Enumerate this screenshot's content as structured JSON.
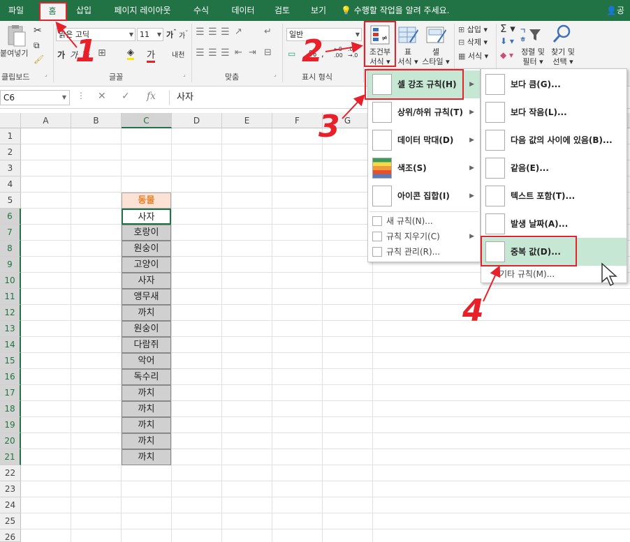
{
  "tabs": [
    "파일",
    "홈",
    "삽입",
    "페이지 레이아웃",
    "수식",
    "데이터",
    "검토",
    "보기"
  ],
  "active_tab": "홈",
  "tell_me": "수행할 작업을 알려 주세요.",
  "share_label": "공",
  "ribbon": {
    "paste_label": "붙여넣기",
    "clipboard_group": "클립보드",
    "font_name": "맑은 고딕",
    "font_size": "11",
    "font_group": "글꼴",
    "align_group": "맞춤",
    "number_format": "일반",
    "number_group": "표시 형식",
    "conditional_format_label_1": "조건부",
    "conditional_format_label_2": "서식",
    "table_format_label_1": "표",
    "table_format_label_2": "서식",
    "cell_style_label_1": "셀",
    "cell_style_label_2": "스타일",
    "insert_label": "삽입",
    "delete_label": "삭제",
    "format_label": "서식",
    "sort_filter_label_1": "정렬 및",
    "sort_filter_label_2": "필터",
    "find_select_label_1": "찾기 및",
    "find_select_label_2": "선택"
  },
  "formula_bar": {
    "name_box": "C6",
    "fx": "fx",
    "content": "사자"
  },
  "columns": [
    "A",
    "B",
    "C",
    "D",
    "E",
    "F",
    "G"
  ],
  "rows": [
    "1",
    "2",
    "3",
    "4",
    "5",
    "6",
    "7",
    "8",
    "9",
    "10",
    "11",
    "12",
    "13",
    "14",
    "15",
    "16",
    "17",
    "18",
    "19",
    "20",
    "21",
    "22",
    "23",
    "24",
    "25",
    "26"
  ],
  "cells": {
    "header": "동물",
    "values": [
      "사자",
      "호랑이",
      "원숭이",
      "고양이",
      "사자",
      "앵무새",
      "까치",
      "원숭이",
      "다람쥐",
      "악어",
      "독수리",
      "까치",
      "까치",
      "까치",
      "까치",
      "까치"
    ]
  },
  "cf_menu": {
    "items": [
      {
        "label": "셀 강조 규칙(H)"
      },
      {
        "label": "상위/하위 규칙(T)"
      },
      {
        "label": "데이터 막대(D)"
      },
      {
        "label": "색조(S)"
      },
      {
        "label": "아이콘 집합(I)"
      }
    ],
    "small_items": [
      {
        "label": "새 규칙(N)..."
      },
      {
        "label": "규칙 지우기(C)"
      },
      {
        "label": "규칙 관리(R)..."
      }
    ]
  },
  "highlight_menu": {
    "items": [
      {
        "label": "보다 큼(G)..."
      },
      {
        "label": "보다 작음(L)..."
      },
      {
        "label": "다음 값의 사이에 있음(B)..."
      },
      {
        "label": "같음(E)..."
      },
      {
        "label": "텍스트 포함(T)..."
      },
      {
        "label": "발생 날짜(A)..."
      },
      {
        "label": "중복 값(D)..."
      }
    ],
    "more_rules": "기타 규칙(M)..."
  },
  "annotations": [
    "1",
    "2",
    "3",
    "4"
  ],
  "colors": {
    "excel_green": "#217346",
    "annotation_red": "#e8202a",
    "highlight_green": "#c6e7d4",
    "header_fill": "#fbe2d5",
    "header_text": "#f07c21"
  }
}
